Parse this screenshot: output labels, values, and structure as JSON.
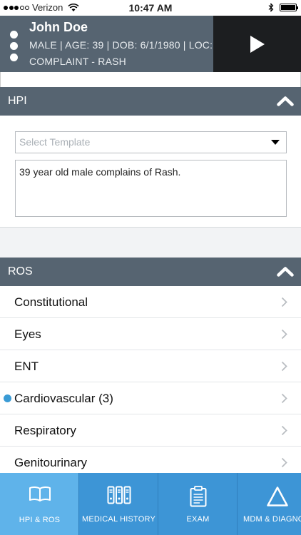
{
  "status_bar": {
    "carrier": "Verizon",
    "time": "10:47 AM"
  },
  "patient": {
    "name": "John Doe",
    "info": "MALE | AGE: 39 | DOB: 6/1/1980 | LOC:",
    "complaint": "COMPLAINT - RASH"
  },
  "hpi": {
    "title": "HPI",
    "template_placeholder": "Select Template",
    "text": "39 year old male complains of Rash."
  },
  "ros": {
    "title": "ROS",
    "items": [
      {
        "label": "Constitutional",
        "flagged": false
      },
      {
        "label": "Eyes",
        "flagged": false
      },
      {
        "label": "ENT",
        "flagged": false
      },
      {
        "label": "Cardiovascular (3)",
        "flagged": true
      },
      {
        "label": "Respiratory",
        "flagged": false
      },
      {
        "label": "Genitourinary",
        "flagged": false
      }
    ]
  },
  "tabs": [
    {
      "label": "HPI & ROS",
      "icon": "book-icon",
      "active": true
    },
    {
      "label": "MEDICAL HISTORY",
      "icon": "binders-icon",
      "active": false
    },
    {
      "label": "EXAM",
      "icon": "clipboard-icon",
      "active": false
    },
    {
      "label": "MDM & DIAGNOS",
      "icon": "triangle-icon",
      "active": false
    }
  ],
  "colors": {
    "header": "#566471",
    "tab_bar": "#3d95d6",
    "tab_active": "#5fb3ea",
    "flag_dot": "#3a9bd5"
  }
}
